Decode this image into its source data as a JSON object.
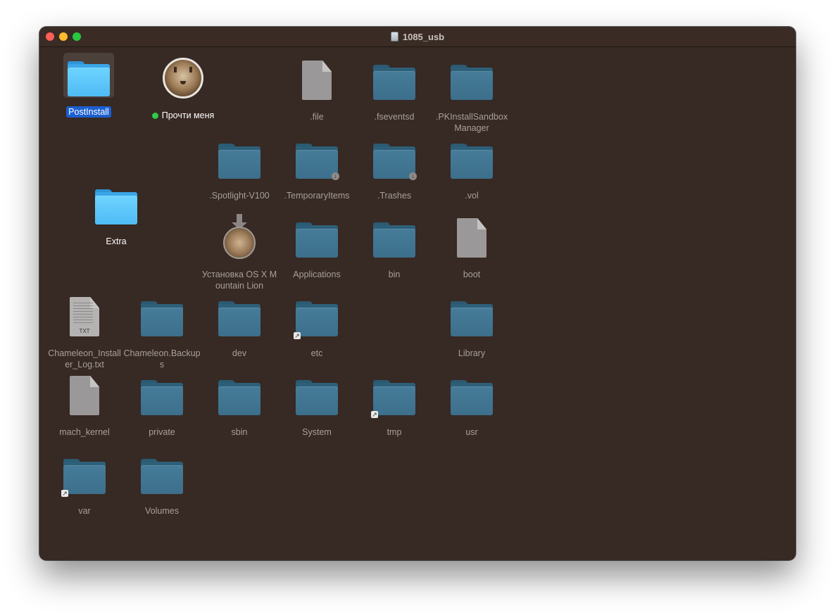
{
  "window": {
    "title": "1085_usb",
    "background": "#372923"
  },
  "items": [
    {
      "label": "PostInstall",
      "kind": "folder",
      "style": "bright",
      "selected": true
    },
    {
      "label": "Прочти меня",
      "kind": "image",
      "tag": "green"
    },
    {
      "label": ".file",
      "kind": "document"
    },
    {
      "label": ".fseventsd",
      "kind": "folder"
    },
    {
      "label": ".PKInstallSandbox Manager",
      "kind": "folder"
    },
    {
      "label": ".Spotlight-V100",
      "kind": "folder"
    },
    {
      "label": ".TemporaryItems",
      "kind": "folder",
      "badge": "download"
    },
    {
      "label": ".Trashes",
      "kind": "folder",
      "badge": "download"
    },
    {
      "label": ".vol",
      "kind": "folder"
    },
    {
      "label": "Extra",
      "kind": "folder",
      "style": "bright"
    },
    {
      "label": "Установка OS X Mountain Lion",
      "kind": "installer"
    },
    {
      "label": "Applications",
      "kind": "folder"
    },
    {
      "label": "bin",
      "kind": "folder"
    },
    {
      "label": "boot",
      "kind": "document"
    },
    {
      "label": "Chameleon_Installer_Log.txt",
      "kind": "text-document",
      "ext": "TXT"
    },
    {
      "label": "Chameleon.Backups",
      "kind": "folder"
    },
    {
      "label": "dev",
      "kind": "folder"
    },
    {
      "label": "etc",
      "kind": "folder",
      "alias": true
    },
    {
      "label": "Library",
      "kind": "folder"
    },
    {
      "label": "mach_kernel",
      "kind": "document"
    },
    {
      "label": "private",
      "kind": "folder"
    },
    {
      "label": "sbin",
      "kind": "folder"
    },
    {
      "label": "System",
      "kind": "folder"
    },
    {
      "label": "tmp",
      "kind": "folder",
      "alias": true
    },
    {
      "label": "usr",
      "kind": "folder"
    },
    {
      "label": "var",
      "kind": "folder",
      "alias": true
    },
    {
      "label": "Volumes",
      "kind": "folder"
    }
  ],
  "colors": {
    "selection": "#1c5fd1",
    "tag_green": "#2ecc4a"
  }
}
